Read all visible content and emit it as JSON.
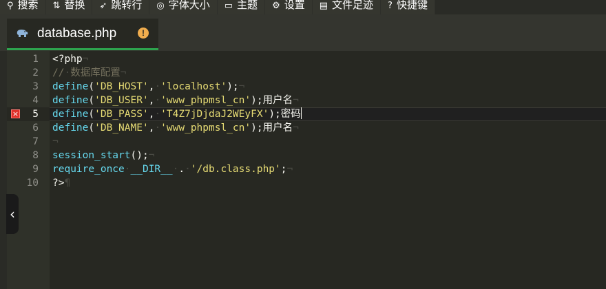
{
  "toolbar": {
    "items": [
      {
        "label": "搜索",
        "icon": "search-icon",
        "glyph": "⚲"
      },
      {
        "label": "替换",
        "icon": "replace-icon",
        "glyph": "⇅"
      },
      {
        "label": "跳转行",
        "icon": "goto-line-icon",
        "glyph": "➶"
      },
      {
        "label": "字体大小",
        "icon": "font-size-icon",
        "glyph": "◎"
      },
      {
        "label": "主题",
        "icon": "theme-icon",
        "glyph": "▭"
      },
      {
        "label": "设置",
        "icon": "settings-icon",
        "glyph": "⚙"
      },
      {
        "label": "文件足迹",
        "icon": "file-history-icon",
        "glyph": "▤"
      },
      {
        "label": "快捷键",
        "icon": "help-icon",
        "glyph": "?"
      }
    ]
  },
  "tab": {
    "title": "database.php",
    "icon": "php-elephant-icon",
    "status_icon": "warning-icon",
    "status_glyph": "!"
  },
  "editor": {
    "line_numbers": [
      "1",
      "2",
      "3",
      "4",
      "5",
      "6",
      "7",
      "8",
      "9",
      "10"
    ],
    "active_line": 5,
    "error_line": 5,
    "lines": [
      [
        {
          "t": "plain",
          "v": "<?php"
        },
        {
          "t": "ws",
          "v": "¬"
        }
      ],
      [
        {
          "t": "cmt",
          "v": "//"
        },
        {
          "t": "ws",
          "v": "·"
        },
        {
          "t": "cmt",
          "v": "数据库配置"
        },
        {
          "t": "ws",
          "v": "¬"
        }
      ],
      [
        {
          "t": "kw",
          "v": "define"
        },
        {
          "t": "plain",
          "v": "("
        },
        {
          "t": "str",
          "v": "'DB_HOST'"
        },
        {
          "t": "plain",
          "v": ","
        },
        {
          "t": "ws",
          "v": "·"
        },
        {
          "t": "str",
          "v": "'localhost'"
        },
        {
          "t": "plain",
          "v": ");"
        },
        {
          "t": "ws",
          "v": "¬"
        }
      ],
      [
        {
          "t": "kw",
          "v": "define"
        },
        {
          "t": "plain",
          "v": "("
        },
        {
          "t": "str",
          "v": "'DB_USER'"
        },
        {
          "t": "plain",
          "v": ","
        },
        {
          "t": "ws",
          "v": "·"
        },
        {
          "t": "str",
          "v": "'www_phpmsl_cn'"
        },
        {
          "t": "plain",
          "v": ");"
        },
        {
          "t": "cjk",
          "v": "用户名"
        },
        {
          "t": "ws",
          "v": "¬"
        }
      ],
      [
        {
          "t": "kw",
          "v": "define"
        },
        {
          "t": "plain",
          "v": "("
        },
        {
          "t": "str",
          "v": "'DB_PASS'"
        },
        {
          "t": "plain",
          "v": ","
        },
        {
          "t": "ws",
          "v": "·"
        },
        {
          "t": "str",
          "v": "'T4Z7jDjdaJ2WEyFX'"
        },
        {
          "t": "plain",
          "v": ");"
        },
        {
          "t": "cjk",
          "v": "密码"
        },
        {
          "t": "cursor",
          "v": ""
        }
      ],
      [
        {
          "t": "kw",
          "v": "define"
        },
        {
          "t": "plain",
          "v": "("
        },
        {
          "t": "str",
          "v": "'DB_NAME'"
        },
        {
          "t": "plain",
          "v": ","
        },
        {
          "t": "ws",
          "v": "·"
        },
        {
          "t": "str",
          "v": "'www_phpmsl_cn'"
        },
        {
          "t": "plain",
          "v": ");"
        },
        {
          "t": "cjk",
          "v": "用户名"
        },
        {
          "t": "ws",
          "v": "¬"
        }
      ],
      [
        {
          "t": "ws",
          "v": "¬"
        }
      ],
      [
        {
          "t": "kw",
          "v": "session_start"
        },
        {
          "t": "plain",
          "v": "();"
        },
        {
          "t": "ws",
          "v": "¬"
        }
      ],
      [
        {
          "t": "kw",
          "v": "require_once"
        },
        {
          "t": "ws",
          "v": "·"
        },
        {
          "t": "kw",
          "v": "__DIR__"
        },
        {
          "t": "ws",
          "v": "·"
        },
        {
          "t": "plain",
          "v": "."
        },
        {
          "t": "ws",
          "v": "·"
        },
        {
          "t": "str",
          "v": "'/db.class.php'"
        },
        {
          "t": "plain",
          "v": ";"
        },
        {
          "t": "ws",
          "v": "¬"
        }
      ],
      [
        {
          "t": "plain",
          "v": "?>"
        },
        {
          "t": "ws",
          "v": "¶"
        }
      ]
    ]
  },
  "side_toggle": {
    "glyph": "‹",
    "icon": "collapse-sidebar-icon"
  },
  "colors": {
    "keyword": "#66d9ef",
    "string": "#e6db74",
    "comment": "#75715e",
    "text": "#f8f8f2",
    "tab_underline": "#2da44e",
    "warning": "#f0ad4e",
    "error": "#e0312a"
  }
}
